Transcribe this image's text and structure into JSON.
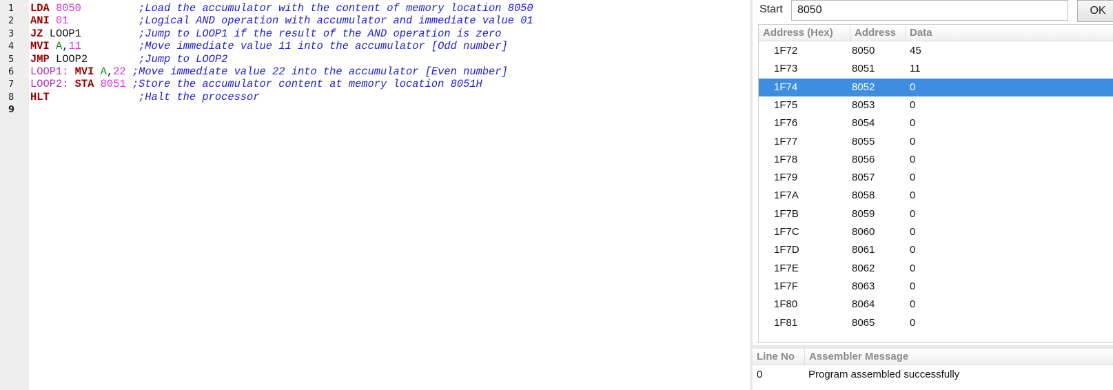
{
  "editor": {
    "lines": [
      {
        "number": "1",
        "segments": [
          {
            "text": "LDA ",
            "kind": "mnemonic"
          },
          {
            "text": "8050",
            "kind": "number"
          },
          {
            "text": "         ",
            "kind": "plain"
          },
          {
            "text": ";Load the accumulator with the content of memory location 8050",
            "kind": "comment"
          }
        ]
      },
      {
        "number": "2",
        "segments": [
          {
            "text": "ANI ",
            "kind": "mnemonic"
          },
          {
            "text": "01",
            "kind": "number"
          },
          {
            "text": "           ",
            "kind": "plain"
          },
          {
            "text": ";Logical AND operation with accumulator and immediate value 01",
            "kind": "comment"
          }
        ]
      },
      {
        "number": "3",
        "segments": [
          {
            "text": "JZ ",
            "kind": "mnemonic"
          },
          {
            "text": "LOOP1",
            "kind": "operand"
          },
          {
            "text": "         ",
            "kind": "plain"
          },
          {
            "text": ";Jump to LOOP1 if the result of the AND operation is zero",
            "kind": "comment"
          }
        ]
      },
      {
        "number": "4",
        "segments": [
          {
            "text": "MVI ",
            "kind": "mnemonic"
          },
          {
            "text": "A",
            "kind": "register"
          },
          {
            "text": ",",
            "kind": "operand"
          },
          {
            "text": "11",
            "kind": "number"
          },
          {
            "text": "         ",
            "kind": "plain"
          },
          {
            "text": ";Move immediate value 11 into the accumulator [Odd number]",
            "kind": "comment"
          }
        ]
      },
      {
        "number": "5",
        "segments": [
          {
            "text": "JMP ",
            "kind": "mnemonic"
          },
          {
            "text": "LOOP2",
            "kind": "operand"
          },
          {
            "text": "        ",
            "kind": "plain"
          },
          {
            "text": ";Jump to LOOP2",
            "kind": "comment"
          }
        ]
      },
      {
        "number": "6",
        "segments": [
          {
            "text": "LOOP1: ",
            "kind": "label"
          },
          {
            "text": "MVI ",
            "kind": "mnemonic"
          },
          {
            "text": "A",
            "kind": "register"
          },
          {
            "text": ",",
            "kind": "operand"
          },
          {
            "text": "22",
            "kind": "number"
          },
          {
            "text": " ",
            "kind": "plain"
          },
          {
            "text": ";Move immediate value 22 into the accumulator [Even number]",
            "kind": "comment"
          }
        ]
      },
      {
        "number": "7",
        "segments": [
          {
            "text": "LOOP2: ",
            "kind": "label"
          },
          {
            "text": "STA ",
            "kind": "mnemonic"
          },
          {
            "text": "8051",
            "kind": "number"
          },
          {
            "text": " ",
            "kind": "plain"
          },
          {
            "text": ";Store the accumulator content at memory location 8051H",
            "kind": "comment"
          }
        ]
      },
      {
        "number": "8",
        "segments": [
          {
            "text": "HLT",
            "kind": "mnemonic"
          },
          {
            "text": "              ",
            "kind": "plain"
          },
          {
            "text": ";Halt the processor",
            "kind": "comment"
          }
        ]
      },
      {
        "number": "9",
        "segments": []
      }
    ],
    "current_line": "9",
    "colors": {
      "mnemonic": "#990000",
      "number": "#e02ee0",
      "label": "#b030b0",
      "register": "#1a8a1a",
      "comment": "#1c1cd6",
      "operand": "#111111"
    }
  },
  "memory": {
    "start_label": "Start",
    "start_value": "8050",
    "ok_label": "OK",
    "columns": [
      "Address (Hex)",
      "Address",
      "Data"
    ],
    "rows": [
      {
        "hex": "1F72",
        "address": "8050",
        "data": "45"
      },
      {
        "hex": "1F73",
        "address": "8051",
        "data": "11"
      },
      {
        "hex": "1F74",
        "address": "8052",
        "data": "0"
      },
      {
        "hex": "1F75",
        "address": "8053",
        "data": "0"
      },
      {
        "hex": "1F76",
        "address": "8054",
        "data": "0"
      },
      {
        "hex": "1F77",
        "address": "8055",
        "data": "0"
      },
      {
        "hex": "1F78",
        "address": "8056",
        "data": "0"
      },
      {
        "hex": "1F79",
        "address": "8057",
        "data": "0"
      },
      {
        "hex": "1F7A",
        "address": "8058",
        "data": "0"
      },
      {
        "hex": "1F7B",
        "address": "8059",
        "data": "0"
      },
      {
        "hex": "1F7C",
        "address": "8060",
        "data": "0"
      },
      {
        "hex": "1F7D",
        "address": "8061",
        "data": "0"
      },
      {
        "hex": "1F7E",
        "address": "8062",
        "data": "0"
      },
      {
        "hex": "1F7F",
        "address": "8063",
        "data": "0"
      },
      {
        "hex": "1F80",
        "address": "8064",
        "data": "0"
      },
      {
        "hex": "1F81",
        "address": "8065",
        "data": "0"
      }
    ],
    "selected_row": "1F74",
    "selection_color": "#3d8ee0"
  },
  "messages": {
    "columns": [
      "Line No",
      "Assembler Message"
    ],
    "rows": [
      {
        "line": "0",
        "message": "Program assembled successfully"
      }
    ]
  }
}
